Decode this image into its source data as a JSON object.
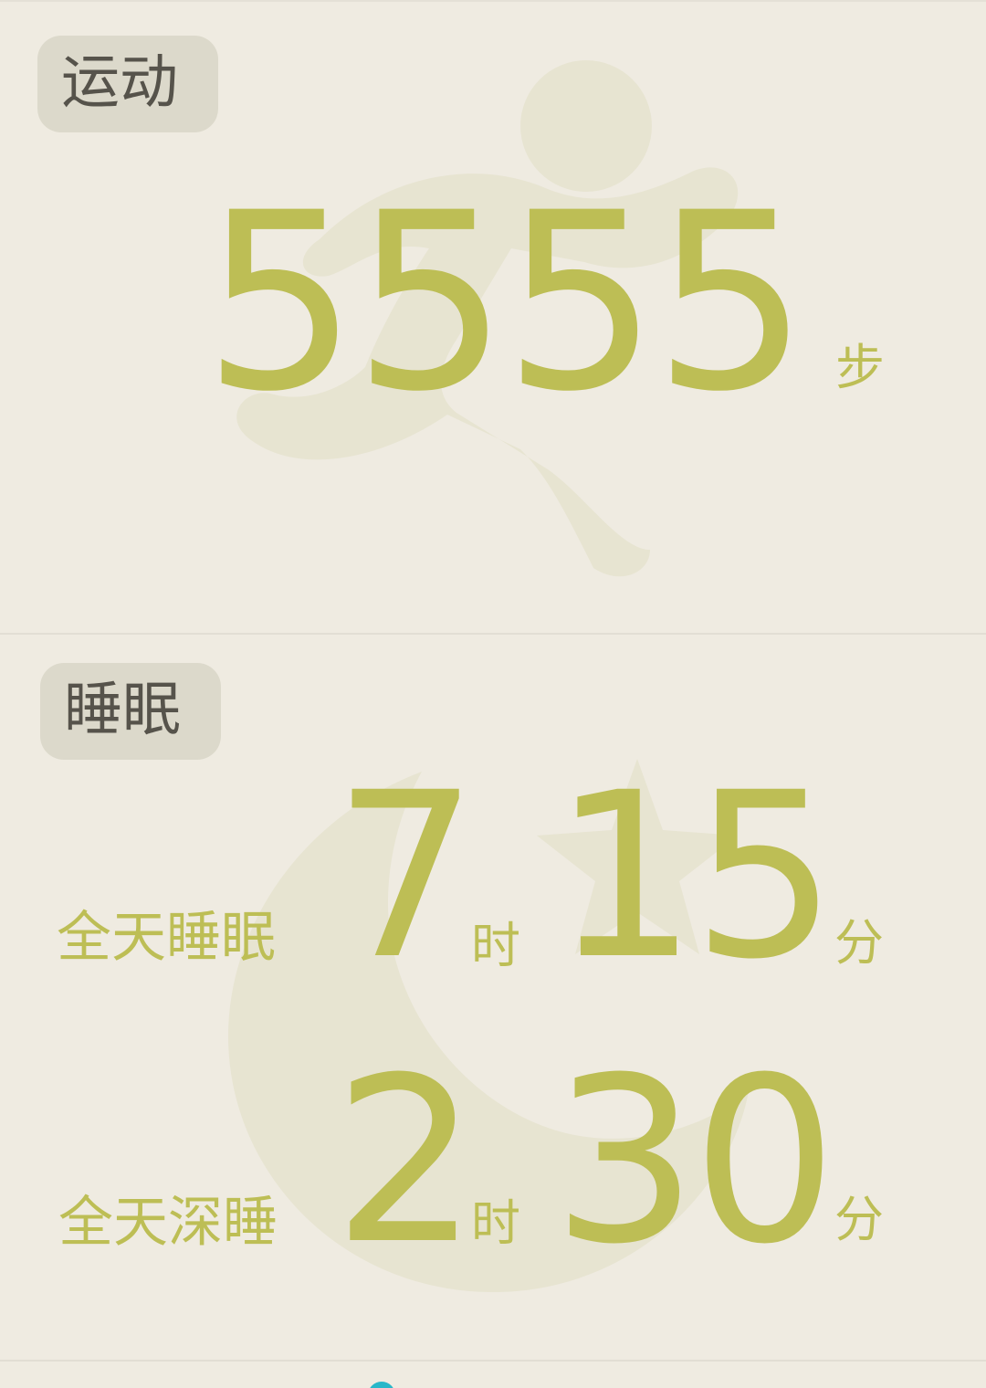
{
  "colors": {
    "background": "#efebe1",
    "accent": "#bdbe55",
    "badge_background": "#dcd9cb",
    "badge_text": "#56534b",
    "watermark": "#e7e4d1",
    "indicator": "#29b7c9"
  },
  "activity": {
    "badge_label": "运动",
    "steps_value": "5555",
    "steps_unit": "步",
    "background_icon": "running-person-icon"
  },
  "sleep": {
    "badge_label": "睡眠",
    "background_icon": "moon-star-icon",
    "total": {
      "label": "全天睡眠",
      "hours": "7",
      "hours_unit": "时",
      "minutes": "15",
      "minutes_unit": "分"
    },
    "deep": {
      "label": "全天深睡",
      "hours": "2",
      "hours_unit": "时",
      "minutes": "30",
      "minutes_unit": "分"
    }
  }
}
